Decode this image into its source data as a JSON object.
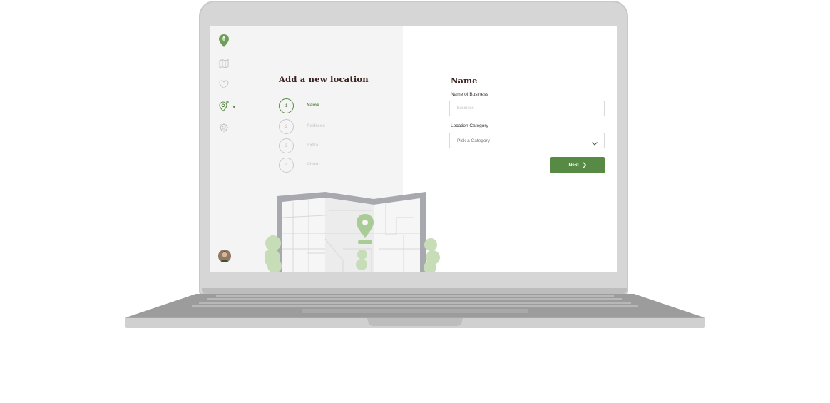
{
  "sidebar": {
    "items": [
      {
        "icon": "leaf-pin-icon"
      },
      {
        "icon": "map-icon"
      },
      {
        "icon": "heart-icon"
      },
      {
        "icon": "add-location-icon",
        "active": true
      },
      {
        "icon": "gear-icon"
      }
    ],
    "avatar_icon": "user-avatar"
  },
  "wizard": {
    "heading": "Add a new location",
    "steps": [
      {
        "number": "1",
        "label": "Name",
        "active": true
      },
      {
        "number": "2",
        "label": "Address",
        "active": false
      },
      {
        "number": "3",
        "label": "Extra",
        "active": false
      },
      {
        "number": "4",
        "label": "Photo",
        "active": false
      }
    ]
  },
  "form": {
    "title": "Name",
    "business_label": "Name of Business",
    "business_placeholder": "business",
    "business_value": "",
    "category_label": "Location Category",
    "category_value": "Pick a Category",
    "next_label": "Next"
  },
  "colors": {
    "accent": "#578b45",
    "heading": "#3a2320",
    "left_pane": "#f4f4f4",
    "laptop": "#d6d6d6"
  }
}
